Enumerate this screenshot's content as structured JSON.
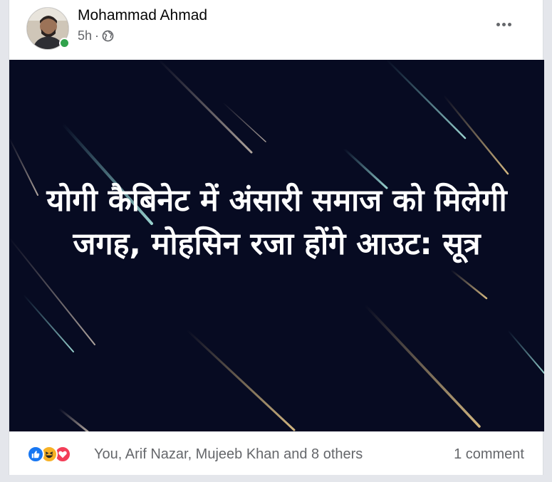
{
  "post": {
    "author": "Mohammad Ahmad",
    "time": "5h",
    "separator": "·",
    "privacy_icon": "globe-icon",
    "more_icon": "more-options-icon",
    "headline": "योगी कैबिनेट में अंसारी समाज को मिलेगी जगह, मोहसिन रजा होंगे आउट: सूत्र"
  },
  "footer": {
    "reaction_icons": [
      "like-icon",
      "haha-icon",
      "love-icon"
    ],
    "reaction_names": "You, Arif Nazar, Mujeeb Khan and 8 others",
    "comments": "1 comment"
  },
  "colors": {
    "like": "#1877f2",
    "haha": "#f7b125",
    "love": "#f33e58",
    "online": "#31a24c",
    "media_bg": "#070b22",
    "secondary_text": "#65676b"
  }
}
